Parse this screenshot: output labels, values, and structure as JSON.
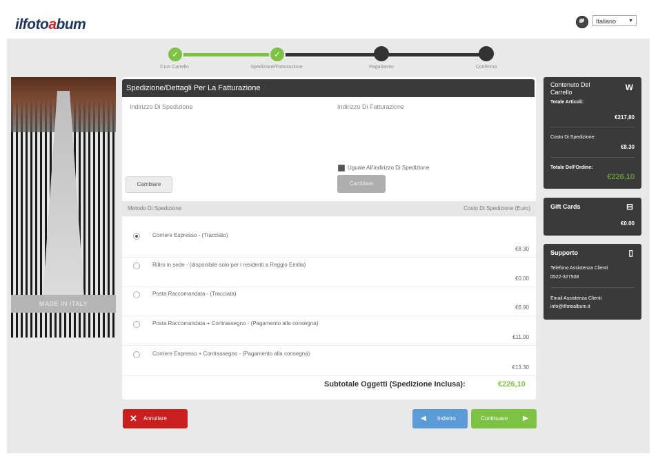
{
  "header": {
    "logo_part1": "ilfoto",
    "logo_part2": "a",
    "logo_part3": "bum",
    "language": "Italiano",
    "globe_icon": "globe-icon"
  },
  "progress": {
    "steps": [
      {
        "label": "Il tuo Carrello",
        "state": "done"
      },
      {
        "label": "Spedizione/Fatturazione",
        "state": "done"
      },
      {
        "label": "Pagamento",
        "state": "todo"
      },
      {
        "label": "Conferma",
        "state": "todo"
      }
    ]
  },
  "photo": {
    "caption": "MADE IN ITALY"
  },
  "main": {
    "title": "Spedizione/Dettagli Per La Fatturazione",
    "shipping_address_label": "Indirizzo Di Spedizione",
    "billing_address_label": "Indirizzo Di Fatturazione",
    "change_button_1": "Cambiare",
    "same_address_label": "Uguale All'indirizzo Di Spedizione",
    "change_button_2": "Cambiare",
    "method_header": "Metodo Di Spedizione",
    "cost_header": "Costo Di Spedizione (Euro)",
    "options": [
      {
        "name": "Corriere Espresso - (Tracciato)",
        "price": "€8.30",
        "selected": true
      },
      {
        "name": "Ritiro in sede - (disponibile solo per i residenti a Reggio Emilia)",
        "price": "€0.00",
        "selected": false
      },
      {
        "name": "Posta Raccomandata - (Tracciata)",
        "price": "€6.90",
        "selected": false
      },
      {
        "name": "Posta Raccomandata + Contrassegno - (Pagamento alla consegna)",
        "price": "€11.90",
        "selected": false
      },
      {
        "name": "Corriere Espresso + Contrassegno - (Pagamento alla consegna)",
        "price": "€13.30",
        "selected": false
      }
    ],
    "subtotal_label": "Subtotale Oggetti (Spedizione Inclusa):",
    "subtotal_value": "€226,10"
  },
  "buttons": {
    "cancel": "Annullare",
    "back": "Indietro",
    "continue": "Continuare"
  },
  "cart_panel": {
    "title_line1": "Contenuto Del",
    "title_line2": "Carrello",
    "icon": "W",
    "items_total_label": "Totale Articoli:",
    "items_total_value": "€217,80",
    "shipping_cost_label": "Costo Di Spedizione:",
    "shipping_cost_value": "€8.30",
    "order_total_label": "Totale Dell'Ordine:",
    "order_total_value": "€226,10"
  },
  "gift_panel": {
    "title": "Gift Cards",
    "value": "€0.00"
  },
  "support_panel": {
    "title": "Supporto",
    "phone_label": "Telefono Assistenza Clienti",
    "phone_value": "0522-327508",
    "email_label": "Email Assistenza Clienti",
    "email_value": "info@ilfotoalbum.it"
  },
  "colors": {
    "accent_green": "#7dc242",
    "dark_panel": "#3a3a3a",
    "cancel_red": "#c9201f",
    "back_blue": "#5b9bd8"
  }
}
